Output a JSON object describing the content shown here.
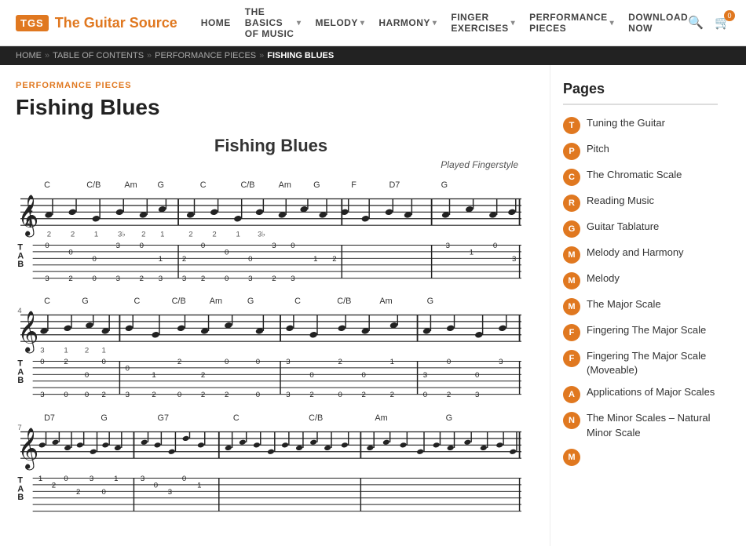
{
  "header": {
    "logo_icon": "TGS",
    "logo_text": "The Guitar Source",
    "nav_items": [
      {
        "label": "HOME",
        "has_arrow": false
      },
      {
        "label": "THE BASICS OF MUSIC",
        "has_arrow": true
      },
      {
        "label": "MELODY",
        "has_arrow": true
      },
      {
        "label": "HARMONY",
        "has_arrow": true
      },
      {
        "label": "FINGER EXERCISES",
        "has_arrow": true
      },
      {
        "label": "PERFORMANCE PIECES",
        "has_arrow": true
      },
      {
        "label": "DOWNLOAD NOW",
        "has_arrow": false
      }
    ],
    "cart_count": "0"
  },
  "breadcrumb": {
    "items": [
      "HOME",
      "TABLE OF CONTENTS",
      "PERFORMANCE PIECES"
    ],
    "current": "FISHING BLUES"
  },
  "content": {
    "section_label": "PERFORMANCE PIECES",
    "page_title": "Fishing Blues",
    "sheet_title": "Fishing Blues",
    "sheet_subtitle": "Played Fingerstyle"
  },
  "sidebar": {
    "title": "Pages",
    "items": [
      {
        "badge": "T",
        "label": "Tuning the Guitar"
      },
      {
        "badge": "P",
        "label": "Pitch"
      },
      {
        "badge": "C",
        "label": "The Chromatic Scale"
      },
      {
        "badge": "R",
        "label": "Reading Music"
      },
      {
        "badge": "G",
        "label": "Guitar Tablature"
      },
      {
        "badge": "M",
        "label": "Melody and Harmony"
      },
      {
        "badge": "M",
        "label": "Melody"
      },
      {
        "badge": "M",
        "label": "The Major Scale"
      },
      {
        "badge": "F",
        "label": "Fingering The Major Scale"
      },
      {
        "badge": "F",
        "label": "Fingering The Major Scale (Moveable)"
      },
      {
        "badge": "A",
        "label": "Applications of Major Scales"
      },
      {
        "badge": "N",
        "label": "The Minor Scales – Natural Minor Scale"
      },
      {
        "badge": "M",
        "label": ""
      }
    ]
  }
}
